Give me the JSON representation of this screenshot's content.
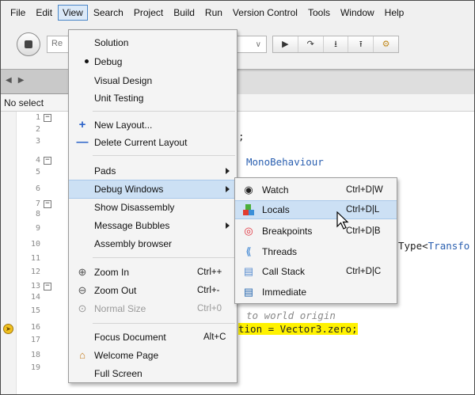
{
  "menubar": {
    "items": [
      "File",
      "Edit",
      "View",
      "Search",
      "Project",
      "Build",
      "Run",
      "Version Control",
      "Tools",
      "Window",
      "Help"
    ],
    "active": "View"
  },
  "toolbar": {
    "config_text": "Re",
    "debug_icons": [
      "▶",
      "↷",
      "⭳",
      "⭱",
      "⚙"
    ]
  },
  "breadcrumb": {
    "text": "No select"
  },
  "editor": {
    "line_numbers": [
      "1",
      "2",
      "3",
      "4",
      "5",
      "6",
      "7",
      "8",
      "9",
      "10",
      "11",
      "12",
      "13",
      "14",
      "15",
      "16",
      "17",
      "18",
      "19"
    ],
    "code": {
      "semicolon": ";",
      "mono_behaviour": "MonoBehaviour",
      "type_prefix": "Type<",
      "type_name": "Transfo",
      "comment": "to world origin",
      "highlight": "tion = Vector3.zero;"
    }
  },
  "view_menu": {
    "solution": "Solution",
    "debug": "Debug",
    "visual_design": "Visual Design",
    "unit_testing": "Unit Testing",
    "new_layout": "New Layout...",
    "delete_layout": "Delete Current Layout",
    "pads": "Pads",
    "debug_windows": "Debug Windows",
    "show_disassembly": "Show Disassembly",
    "message_bubbles": "Message Bubbles",
    "assembly_browser": "Assembly browser",
    "zoom_in": "Zoom In",
    "zoom_in_shortcut": "Ctrl++",
    "zoom_out": "Zoom Out",
    "zoom_out_shortcut": "Ctrl+-",
    "normal_size": "Normal Size",
    "normal_size_shortcut": "Ctrl+0",
    "focus_document": "Focus Document",
    "focus_document_shortcut": "Alt+C",
    "welcome_page": "Welcome Page",
    "full_screen": "Full Screen"
  },
  "debug_windows_menu": {
    "watch": "Watch",
    "watch_shortcut": "Ctrl+D|W",
    "locals": "Locals",
    "locals_shortcut": "Ctrl+D|L",
    "breakpoints": "Breakpoints",
    "breakpoints_shortcut": "Ctrl+D|B",
    "threads": "Threads",
    "call_stack": "Call Stack",
    "call_stack_shortcut": "Ctrl+D|C",
    "immediate": "Immediate"
  }
}
